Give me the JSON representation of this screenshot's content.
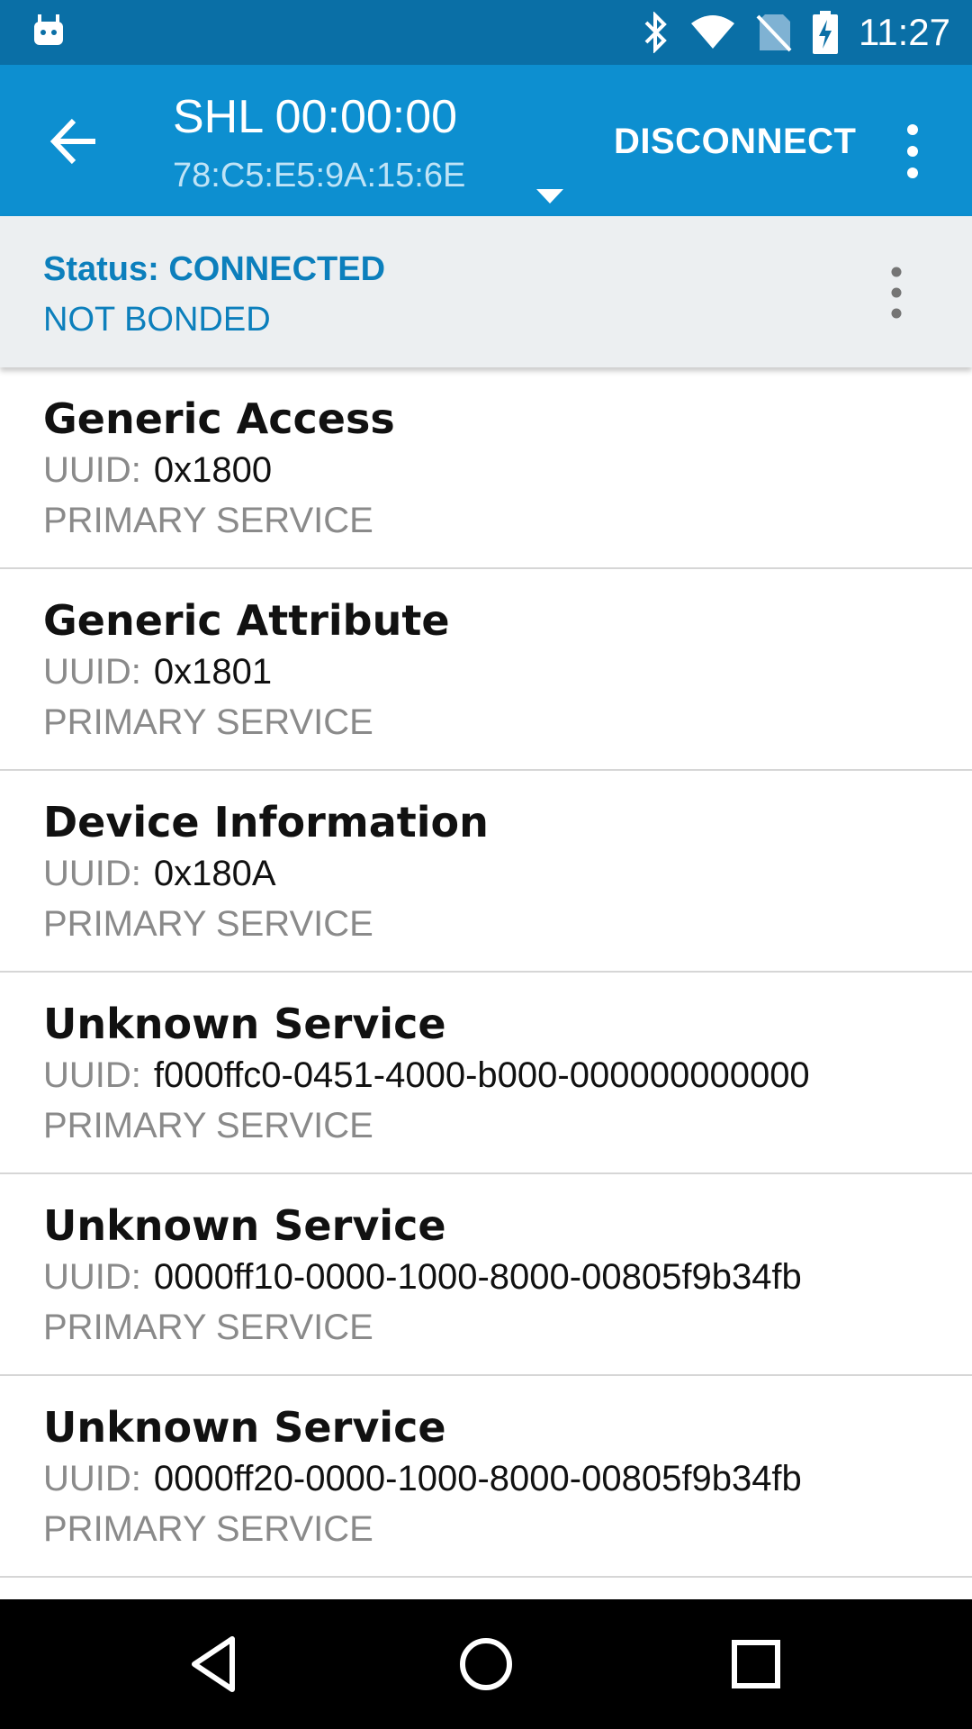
{
  "status_bar": {
    "time": "11:27",
    "icons": [
      "android-icon",
      "bluetooth-icon",
      "wifi-icon",
      "no-sim-icon",
      "battery-charging-icon"
    ]
  },
  "app_bar": {
    "title": "SHL 00:00:00",
    "subtitle": "78:C5:E5:9A:15:6E",
    "disconnect_label": "DISCONNECT",
    "icons": {
      "back": "arrow-back-icon",
      "dropdown": "dropdown-arrow-icon",
      "overflow": "more-vertical-icon"
    }
  },
  "status_panel": {
    "status": "Status: CONNECTED",
    "bond": "NOT BONDED"
  },
  "services": [
    {
      "name": "Generic Access",
      "uuid_label": "UUID:",
      "uuid": "0x1800",
      "type": "PRIMARY SERVICE"
    },
    {
      "name": "Generic Attribute",
      "uuid_label": "UUID:",
      "uuid": "0x1801",
      "type": "PRIMARY SERVICE"
    },
    {
      "name": "Device Information",
      "uuid_label": "UUID:",
      "uuid": "0x180A",
      "type": "PRIMARY SERVICE"
    },
    {
      "name": "Unknown Service",
      "uuid_label": "UUID:",
      "uuid": "f000ffc0-0451-4000-b000-000000000000",
      "type": "PRIMARY SERVICE"
    },
    {
      "name": "Unknown Service",
      "uuid_label": "UUID:",
      "uuid": "0000ff10-0000-1000-8000-00805f9b34fb",
      "type": "PRIMARY SERVICE"
    },
    {
      "name": "Unknown Service",
      "uuid_label": "UUID:",
      "uuid": "0000ff20-0000-1000-8000-00805f9b34fb",
      "type": "PRIMARY SERVICE"
    }
  ],
  "nav_bar": {
    "icons": [
      "nav-back-icon",
      "nav-home-icon",
      "nav-recents-icon"
    ]
  },
  "colors": {
    "status_bar": "#0a6fa6",
    "app_bar": "#0d8fd0",
    "status_panel": "#eceff1",
    "accent_text": "#0c7fbc"
  }
}
